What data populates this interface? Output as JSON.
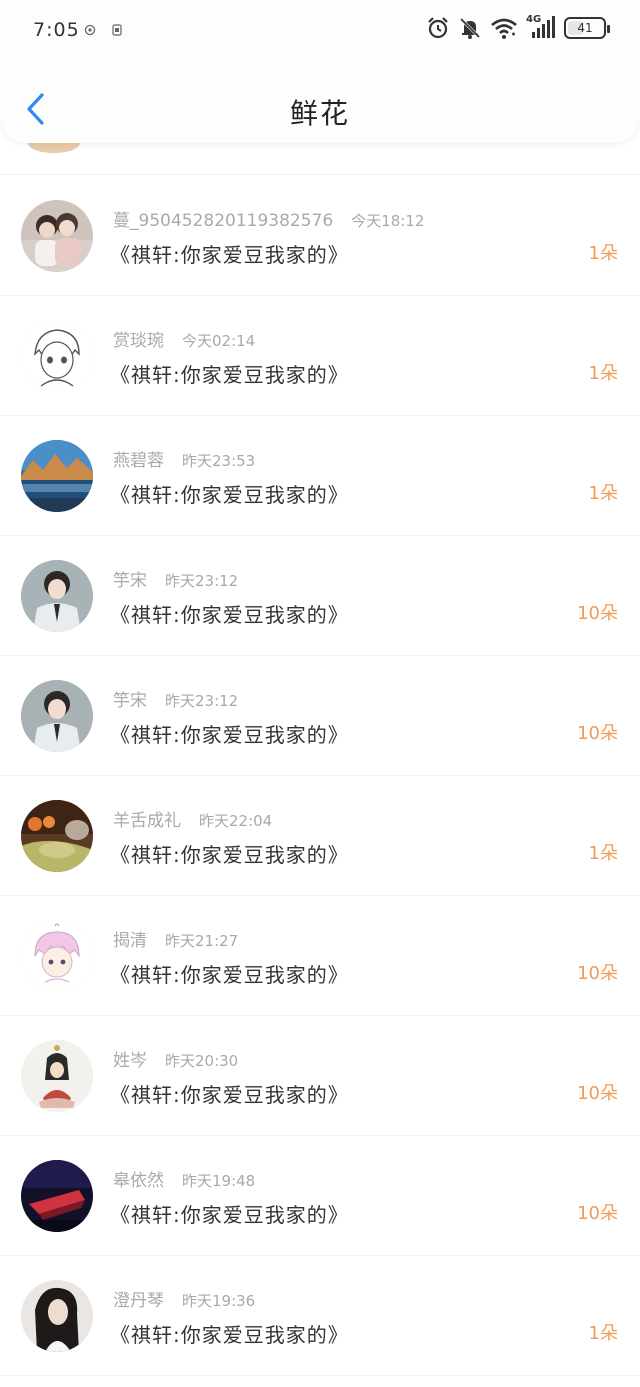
{
  "status_bar": {
    "time": "7:05",
    "battery": "41",
    "network": "4G"
  },
  "header": {
    "title": "鲜花"
  },
  "list": {
    "items": [
      {
        "name": "蔓_950452820119382576",
        "time": "今天18:12",
        "message": "《祺轩:你家爱豆我家的》",
        "count": "1朵",
        "avatar": "two-girls-photo"
      },
      {
        "name": "赏琰琬",
        "time": "今天02:14",
        "message": "《祺轩:你家爱豆我家的》",
        "count": "1朵",
        "avatar": "anime-boy-sketch"
      },
      {
        "name": "燕碧蓉",
        "time": "昨天23:53",
        "message": "《祺轩:你家爱豆我家的》",
        "count": "1朵",
        "avatar": "mountain-lake"
      },
      {
        "name": "竽宋",
        "time": "昨天23:12",
        "message": "《祺轩:你家爱豆我家的》",
        "count": "10朵",
        "avatar": "boy-in-suit"
      },
      {
        "name": "竽宋",
        "time": "昨天23:12",
        "message": "《祺轩:你家爱豆我家的》",
        "count": "10朵",
        "avatar": "boy-in-suit"
      },
      {
        "name": "羊舌成礼",
        "time": "昨天22:04",
        "message": "《祺轩:你家爱豆我家的》",
        "count": "1朵",
        "avatar": "autumn-room"
      },
      {
        "name": "揭清",
        "time": "昨天21:27",
        "message": "《祺轩:你家爱豆我家的》",
        "count": "10朵",
        "avatar": "pink-hair-chibi"
      },
      {
        "name": "姓岑",
        "time": "昨天20:30",
        "message": "《祺轩:你家爱豆我家的》",
        "count": "10朵",
        "avatar": "hooded-anime-girl"
      },
      {
        "name": "皋依然",
        "time": "昨天19:48",
        "message": "《祺轩:你家爱豆我家的》",
        "count": "10朵",
        "avatar": "red-abstract-dark"
      },
      {
        "name": "澄丹琴",
        "time": "昨天19:36",
        "message": "《祺轩:你家爱豆我家的》",
        "count": "1朵",
        "avatar": "dark-hair-girl"
      }
    ]
  },
  "colors": {
    "accent_blue": "#2b8ef0",
    "count_orange": "#ef9b55",
    "meta_gray": "#a9a9a9"
  }
}
